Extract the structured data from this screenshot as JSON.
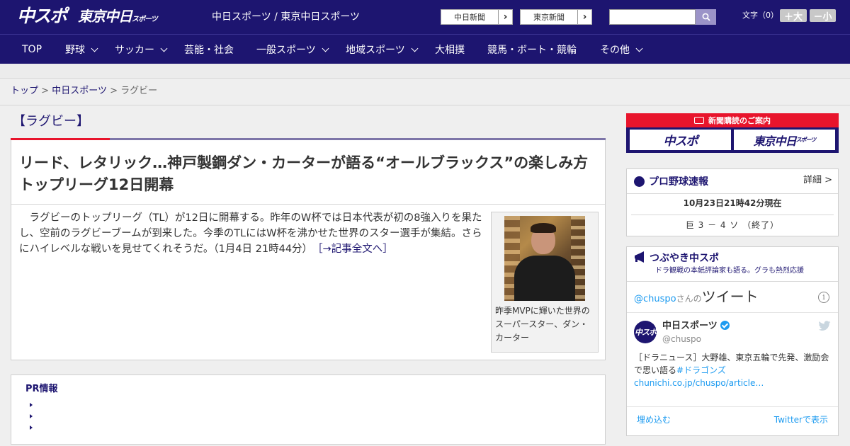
{
  "header": {
    "logo_chuspo": "中スポ",
    "logo_tokyo": "東京中日",
    "logo_tokyo_small": "スポーツ",
    "site_name": "中日スポーツ / 東京中日スポーツ",
    "ext_links": [
      {
        "label": "中日新聞",
        "arrow": "›"
      },
      {
        "label": "東京新聞",
        "arrow": "›"
      }
    ],
    "search_placeholder": "",
    "font_size_label": "文字（0）",
    "font_plus": "＋大",
    "font_minus": "－小"
  },
  "nav": {
    "items": [
      {
        "label": "TOP",
        "dropdown": false
      },
      {
        "label": "野球",
        "dropdown": true
      },
      {
        "label": "サッカー",
        "dropdown": true
      },
      {
        "label": "芸能・社会",
        "dropdown": false
      },
      {
        "label": "一般スポーツ",
        "dropdown": true
      },
      {
        "label": "地域スポーツ",
        "dropdown": true
      },
      {
        "label": "大相撲",
        "dropdown": false
      },
      {
        "label": "競馬・ボート・競輪",
        "dropdown": false
      },
      {
        "label": "その他",
        "dropdown": true
      }
    ]
  },
  "breadcrumb": {
    "items": [
      "トップ",
      "中日スポーツ",
      "ラグビー"
    ],
    "separator": ">"
  },
  "article": {
    "category": "【ラグビー】",
    "title": "リード、レタリック…神戸製鋼ダン・カーターが語る“オールブラックス”の楽しみ方　トップリーグ12日開幕",
    "lead": "ラグビーのトップリーグ（TL）が12日に開幕する。昨年のW杯では日本代表が初の8強入りを果たし、空前のラグビーブームが到来した。今季のTLにはW杯を沸かせた世界のスター選手が集結。さらにハイレベルな戦いを見せてくれそうだ。（1月4日 21時44分）",
    "more_link": "［→記事全文へ］",
    "photo_caption": "昨季MVPに輝いた世界のスーパースター、ダン・カーター"
  },
  "pr": {
    "title": "PR情報",
    "items": [
      "",
      "",
      ""
    ]
  },
  "sidebar": {
    "subscribe": {
      "title": "新聞購読のご案内",
      "logos": [
        "中スポ",
        "東京中日"
      ],
      "logo_small": "スポーツ"
    },
    "baseball": {
      "title": "プロ野球速報",
      "more": "詳細 >",
      "updated": "10月23日21時42分現在",
      "game": "巨 3 － 4 ソ （終了）"
    },
    "twitter": {
      "title": "つぶやき中スポ",
      "subtitle": "ドラ観戦の本紙評論家も語る。グラも熱烈応援",
      "handle": "@chuspo",
      "handle_suffix": "さんの",
      "heading": "ツイート",
      "info": "i",
      "avatar": "中スポ",
      "name": "中日スポーツ",
      "account": "@chuspo",
      "text": "［ドラニュース］大野雄、東京五輪で先発、激励会で思い語る",
      "hashtag": "#ドラゴンズ",
      "link": "chunichi.co.jp/chuspo/article…",
      "embed": "埋め込む",
      "view": "Twitterで表示"
    }
  },
  "colors": {
    "brand_navy": "#1d1570",
    "accent_red": "#e8142c",
    "twitter_blue": "#1d9bf0"
  }
}
